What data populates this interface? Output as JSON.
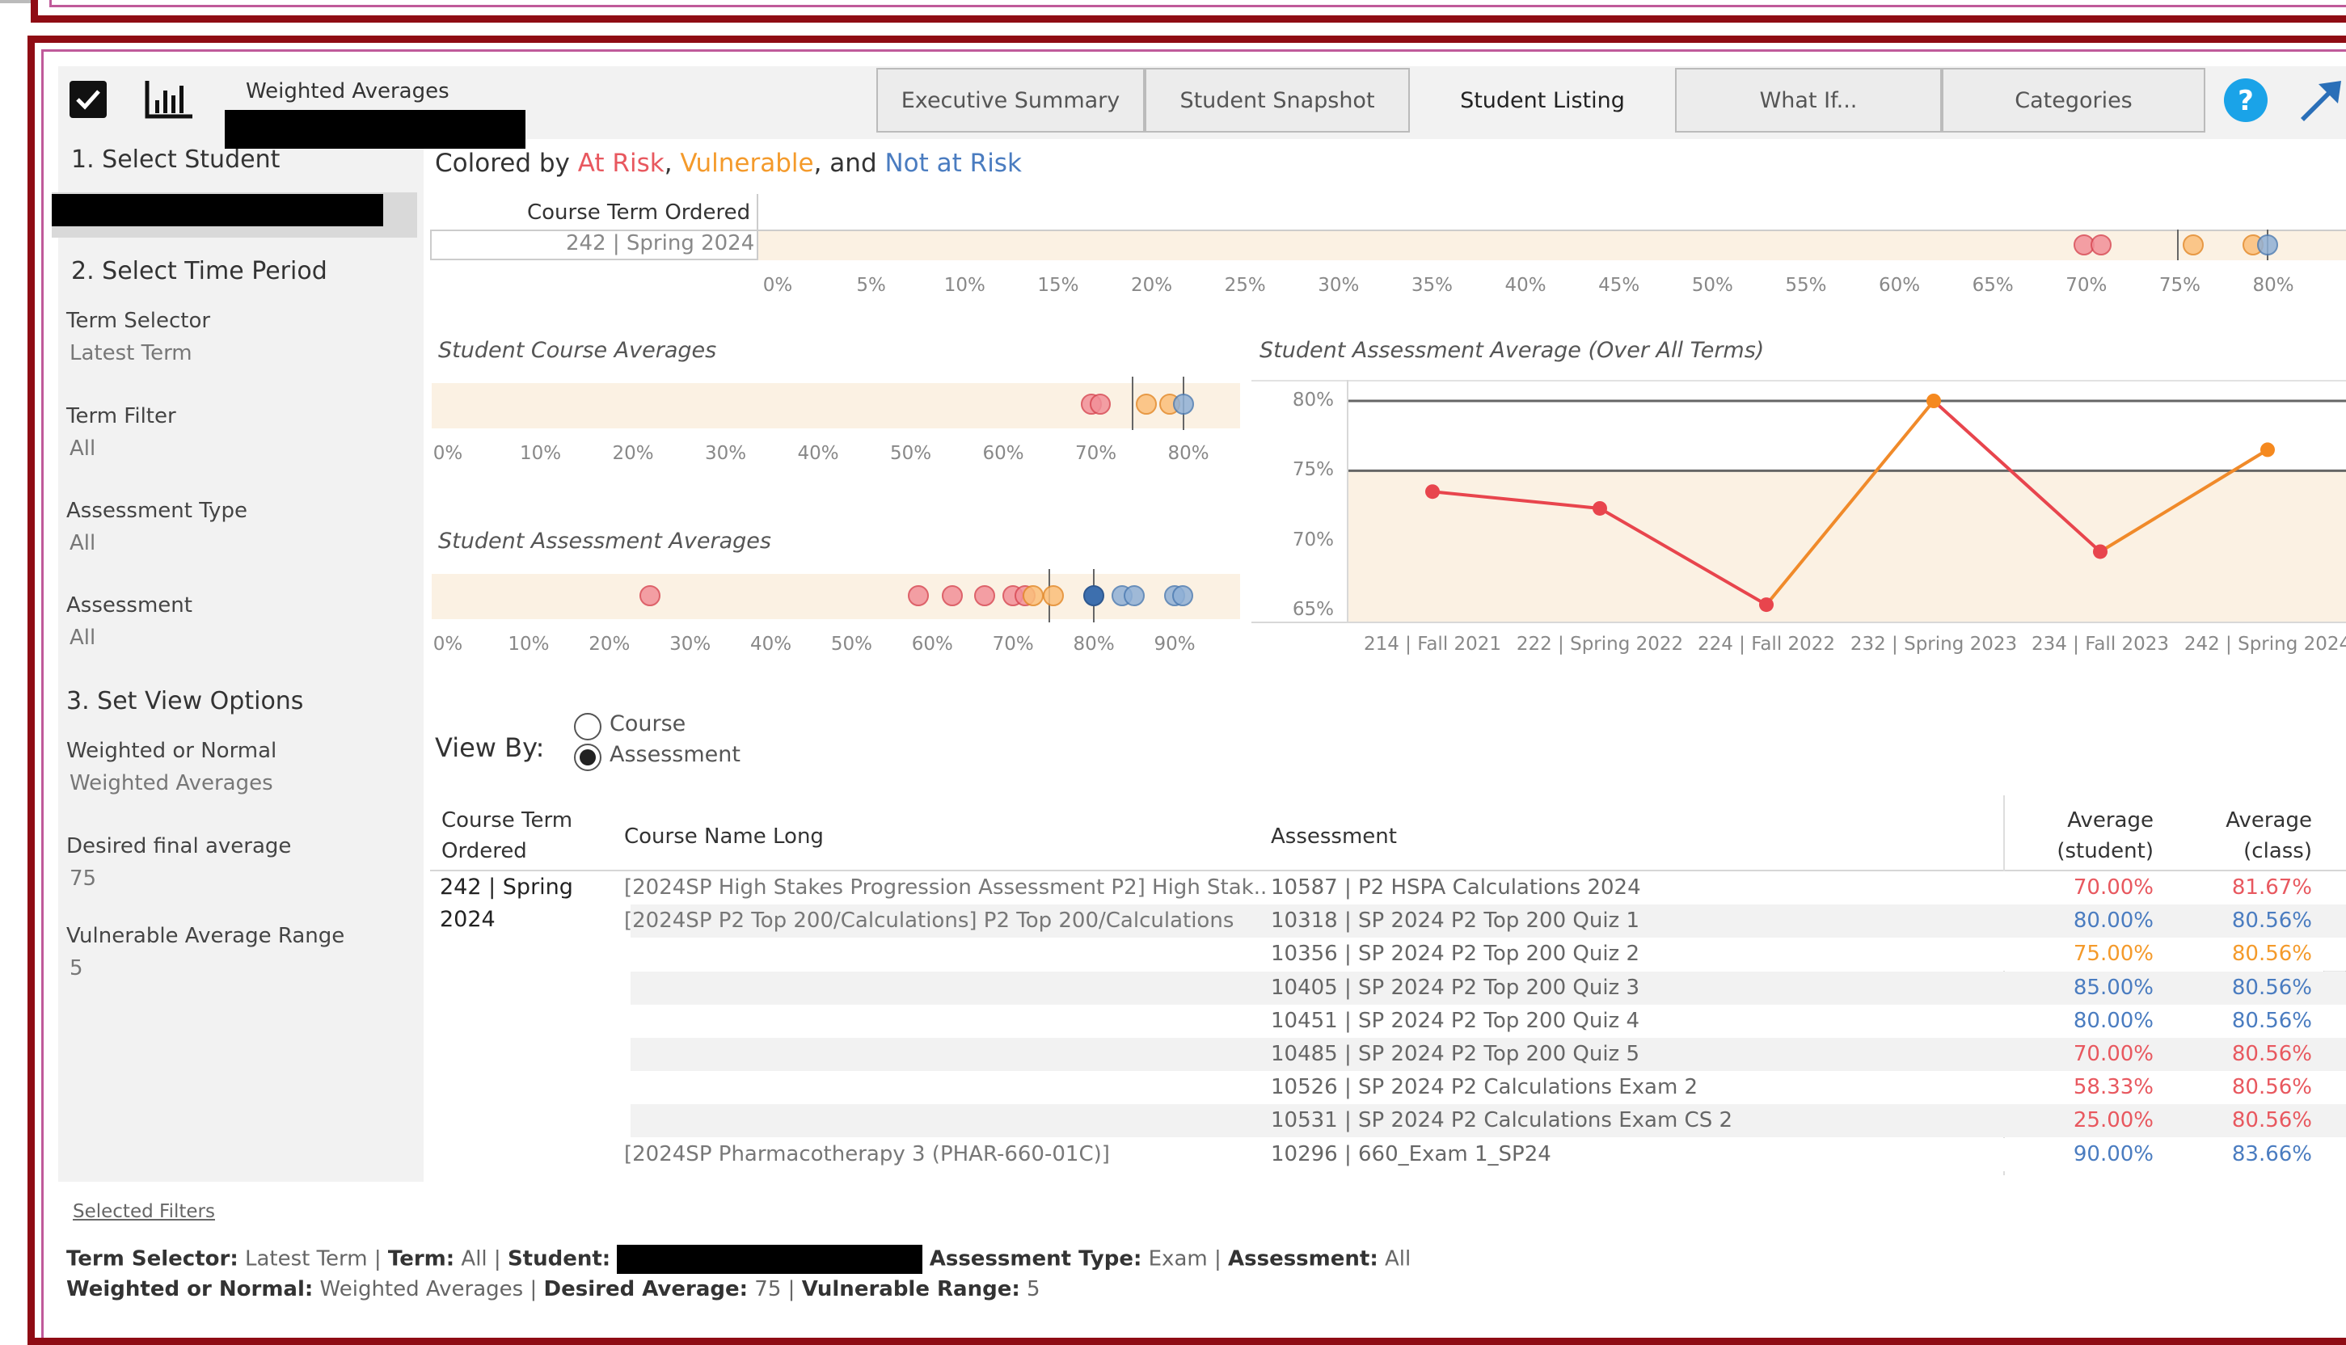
{
  "header": {
    "app_title": "Weighted Averages",
    "tabs": [
      "Executive Summary",
      "Student Snapshot",
      "Student Listing",
      "What If...",
      "Categories"
    ],
    "active_tab": "Student Listing"
  },
  "sidebar": {
    "select_student_heading": "1. Select Student",
    "select_time_heading": "2. Select Time Period",
    "term_selector_label": "Term Selector",
    "term_selector_value": "Latest Term",
    "term_filter_label": "Term Filter",
    "term_filter_value": "All",
    "assessment_type_label": "Assessment Type",
    "assessment_type_value": "All",
    "assessment_label": "Assessment",
    "assessment_value": "All",
    "view_options_heading": "3. Set View Options",
    "weighted_label": "Weighted or Normal",
    "weighted_value": "Weighted Averages",
    "desired_label": "Desired final average",
    "desired_value": "75",
    "vuln_range_label": "Vulnerable Average Range",
    "vuln_range_value": "5"
  },
  "legend": {
    "prefix": "Colored by ",
    "at_risk": "At Risk",
    "sep1": ", ",
    "vulnerable": "Vulnerable",
    "sep2": ", and ",
    "not_at_risk": "Not at Risk"
  },
  "colors": {
    "at_risk": "#e8585f",
    "vulnerable": "#f49a2b",
    "not_at_risk": "#4a7cc0"
  },
  "term_chart": {
    "column_header": "Course Term Ordered",
    "row_label": "242 | Spring 2024",
    "ticks": [
      "0%",
      "5%",
      "10%",
      "15%",
      "20%",
      "25%",
      "30%",
      "35%",
      "40%",
      "45%",
      "50%",
      "55%",
      "60%",
      "65%",
      "70%",
      "75%",
      "80%"
    ]
  },
  "course_avg_chart": {
    "title": "Student Course Averages",
    "ticks": [
      "0%",
      "10%",
      "20%",
      "30%",
      "40%",
      "50%",
      "60%",
      "70%",
      "80%"
    ]
  },
  "assessment_avg_chart": {
    "title": "Student Assessment Averages",
    "ticks": [
      "0%",
      "10%",
      "20%",
      "30%",
      "40%",
      "50%",
      "60%",
      "70%",
      "80%",
      "90%"
    ]
  },
  "line_chart": {
    "title": "Student Assessment Average (Over All Terms)",
    "y_ticks": [
      "80%",
      "75%",
      "70%",
      "65%"
    ],
    "x_ticks": [
      "214 | Fall 2021",
      "222 | Spring 2022",
      "224 | Fall 2022",
      "232 | Spring 2023",
      "234 | Fall 2023",
      "242 | Spring 2024"
    ]
  },
  "chart_data": [
    {
      "type": "scatter",
      "title": "",
      "row": "242 | Spring 2024",
      "xlim": [
        0,
        80
      ],
      "points": [
        {
          "value": 69.9,
          "status": "at_risk"
        },
        {
          "value": 70.8,
          "status": "at_risk"
        },
        {
          "value": 75.7,
          "status": "vulnerable"
        },
        {
          "value": 78.9,
          "status": "vulnerable"
        },
        {
          "value": 79.7,
          "status": "not_at_risk"
        }
      ],
      "reference_lines": [
        74.9,
        79.7
      ]
    },
    {
      "type": "scatter",
      "title": "Student Course Averages",
      "xlim": [
        0,
        80
      ],
      "points": [
        {
          "value": 69.5,
          "status": "at_risk"
        },
        {
          "value": 70.5,
          "status": "at_risk"
        },
        {
          "value": 75.5,
          "status": "vulnerable"
        },
        {
          "value": 78.0,
          "status": "vulnerable"
        },
        {
          "value": 79.5,
          "status": "not_at_risk"
        }
      ],
      "reference_lines": [
        74.0,
        79.5
      ]
    },
    {
      "type": "scatter",
      "title": "Student Assessment Averages",
      "xlim": [
        0,
        90
      ],
      "points": [
        {
          "value": 25,
          "status": "at_risk"
        },
        {
          "value": 58.3,
          "status": "at_risk"
        },
        {
          "value": 62.5,
          "status": "at_risk"
        },
        {
          "value": 66.5,
          "status": "at_risk"
        },
        {
          "value": 70,
          "status": "at_risk"
        },
        {
          "value": 71.5,
          "status": "at_risk"
        },
        {
          "value": 72.5,
          "status": "vulnerable"
        },
        {
          "value": 75,
          "status": "vulnerable"
        },
        {
          "value": 80,
          "status": "not_at_risk_dark"
        },
        {
          "value": 83.5,
          "status": "not_at_risk"
        },
        {
          "value": 85,
          "status": "not_at_risk"
        },
        {
          "value": 90,
          "status": "not_at_risk"
        },
        {
          "value": 91,
          "status": "not_at_risk"
        }
      ],
      "reference_lines": [
        74.5,
        80
      ]
    },
    {
      "type": "line",
      "title": "Student Assessment Average (Over All Terms)",
      "x": [
        "214 | Fall 2021",
        "222 | Spring 2022",
        "224 | Fall 2022",
        "232 | Spring 2023",
        "234 | Fall 2023",
        "242 | Spring 2024"
      ],
      "values": [
        73.5,
        72.3,
        65.4,
        80.0,
        69.2,
        76.5
      ],
      "point_colors": [
        "at_risk",
        "at_risk",
        "at_risk",
        "vulnerable",
        "at_risk",
        "vulnerable"
      ],
      "ylim": [
        64.2,
        81.2
      ],
      "reference_lines": [
        80,
        75
      ]
    }
  ],
  "view_by": {
    "label": "View By:",
    "options": [
      "Course",
      "Assessment"
    ],
    "selected": "Assessment"
  },
  "table": {
    "headers": {
      "term_line1": "Course Term",
      "term_line2": "Ordered",
      "course": "Course Name Long",
      "assessment": "Assessment",
      "avg_student_line1": "Average",
      "avg_student_line2": "(student)",
      "avg_class_line1": "Average",
      "avg_class_line2": "(class)"
    },
    "term_line1": "242 | Spring",
    "term_line2": "2024",
    "courses": [
      "[2024SP High Stakes Progression Assessment P2] High Stak..",
      "[2024SP P2 Top 200/Calculations] P2 Top 200/Calculations",
      "[2024SP Pharmacotherapy 3 (PHAR-660-01C)]"
    ],
    "rows": [
      {
        "assessment": "10587 | P2 HSPA Calculations 2024",
        "student": "70.00%",
        "student_status": "at_risk",
        "class": "81.67%",
        "class_status": "at_risk"
      },
      {
        "assessment": "10318 | SP 2024 P2 Top 200 Quiz 1",
        "student": "80.00%",
        "student_status": "not_at_risk",
        "class": "80.56%",
        "class_status": "not_at_risk"
      },
      {
        "assessment": "10356 | SP 2024 P2 Top 200 Quiz 2",
        "student": "75.00%",
        "student_status": "vulnerable",
        "class": "80.56%",
        "class_status": "vulnerable"
      },
      {
        "assessment": "10405 | SP 2024 P2 Top 200 Quiz 3",
        "student": "85.00%",
        "student_status": "not_at_risk",
        "class": "80.56%",
        "class_status": "not_at_risk"
      },
      {
        "assessment": "10451 | SP 2024 P2 Top 200 Quiz 4",
        "student": "80.00%",
        "student_status": "not_at_risk",
        "class": "80.56%",
        "class_status": "not_at_risk"
      },
      {
        "assessment": "10485 | SP 2024 P2 Top 200 Quiz 5",
        "student": "70.00%",
        "student_status": "at_risk",
        "class": "80.56%",
        "class_status": "at_risk"
      },
      {
        "assessment": "10526 | SP 2024 P2 Calculations Exam 2",
        "student": "58.33%",
        "student_status": "at_risk",
        "class": "80.56%",
        "class_status": "at_risk"
      },
      {
        "assessment": "10531 | SP 2024 P2 Calculations Exam CS 2",
        "student": "25.00%",
        "student_status": "at_risk",
        "class": "80.56%",
        "class_status": "at_risk"
      },
      {
        "assessment": "10296 | 660_Exam 1_SP24",
        "student": "90.00%",
        "student_status": "not_at_risk",
        "class": "83.66%",
        "class_status": "not_at_risk"
      }
    ]
  },
  "footer": {
    "selected_filters": "Selected Filters",
    "term_selector_label": "Term Selector:",
    "term_selector_value": "Latest Term",
    "term_label": "Term:",
    "term_value": "All",
    "student_label": "Student:",
    "assessment_type_label": "Assessment Type:",
    "assessment_type_value": "Exam",
    "assessment_label": "Assessment:",
    "assessment_value": "All",
    "weighted_label": "Weighted or Normal:",
    "weighted_value": "Weighted Averages",
    "desired_label": "Desired Average:",
    "desired_value": "75",
    "vuln_label": "Vulnerable Range:",
    "vuln_value": "5",
    "separator": "|"
  }
}
